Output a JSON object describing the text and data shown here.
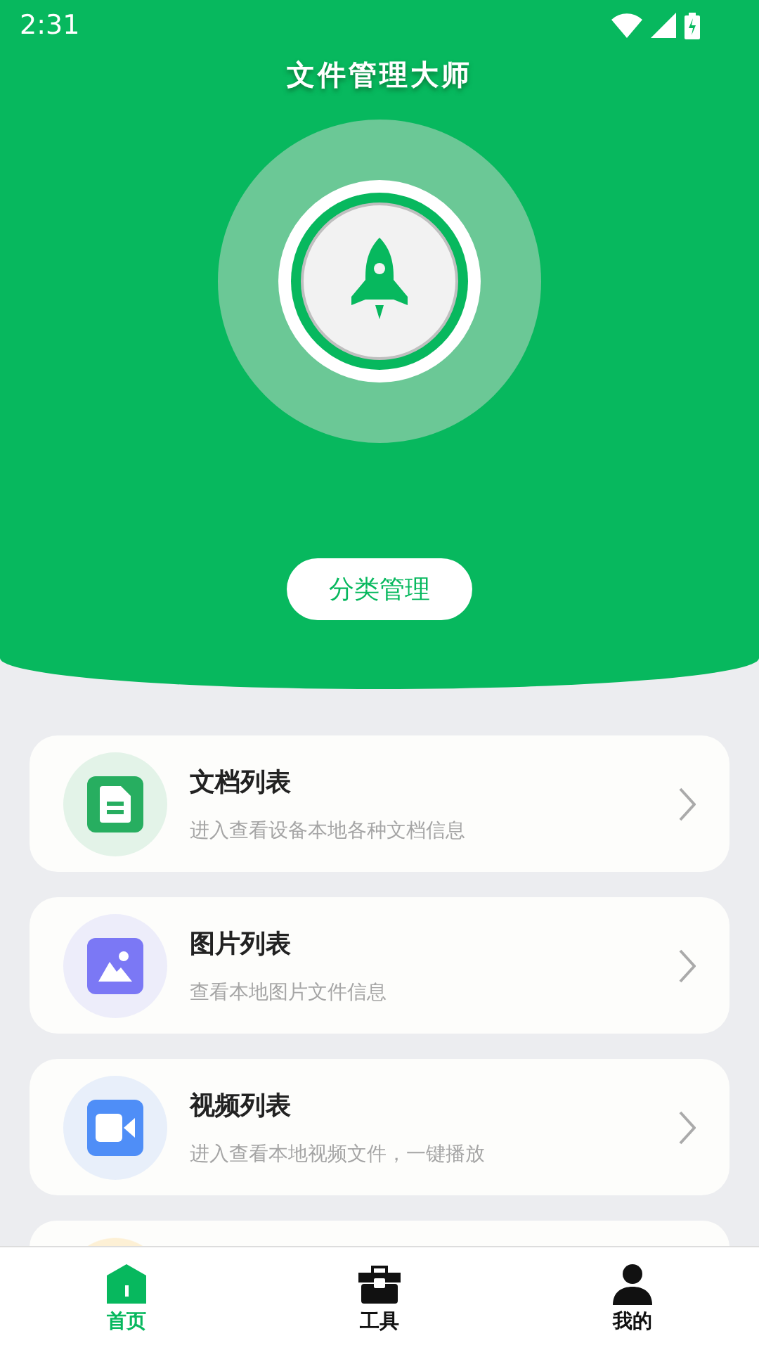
{
  "status_bar": {
    "time": "2:31"
  },
  "header": {
    "title": "文件管理大师",
    "button": "分类管理"
  },
  "cards": [
    {
      "kind": "document",
      "title": "文档列表",
      "subtitle": "进入查看设备本地各种文档信息",
      "color": "#27ae60"
    },
    {
      "kind": "image",
      "title": "图片列表",
      "subtitle": "查看本地图片文件信息",
      "color": "#7b78f5"
    },
    {
      "kind": "video",
      "title": "视频列表",
      "subtitle": "进入查看本地视频文件，一键播放",
      "color": "#4f8ef7"
    },
    {
      "kind": "partial",
      "color": "#fdf0d5"
    }
  ],
  "nav": [
    {
      "kind": "home",
      "label": "首页",
      "selected": true
    },
    {
      "kind": "tools",
      "label": "工具",
      "selected": false
    },
    {
      "kind": "profile",
      "label": "我的",
      "selected": false
    }
  ]
}
